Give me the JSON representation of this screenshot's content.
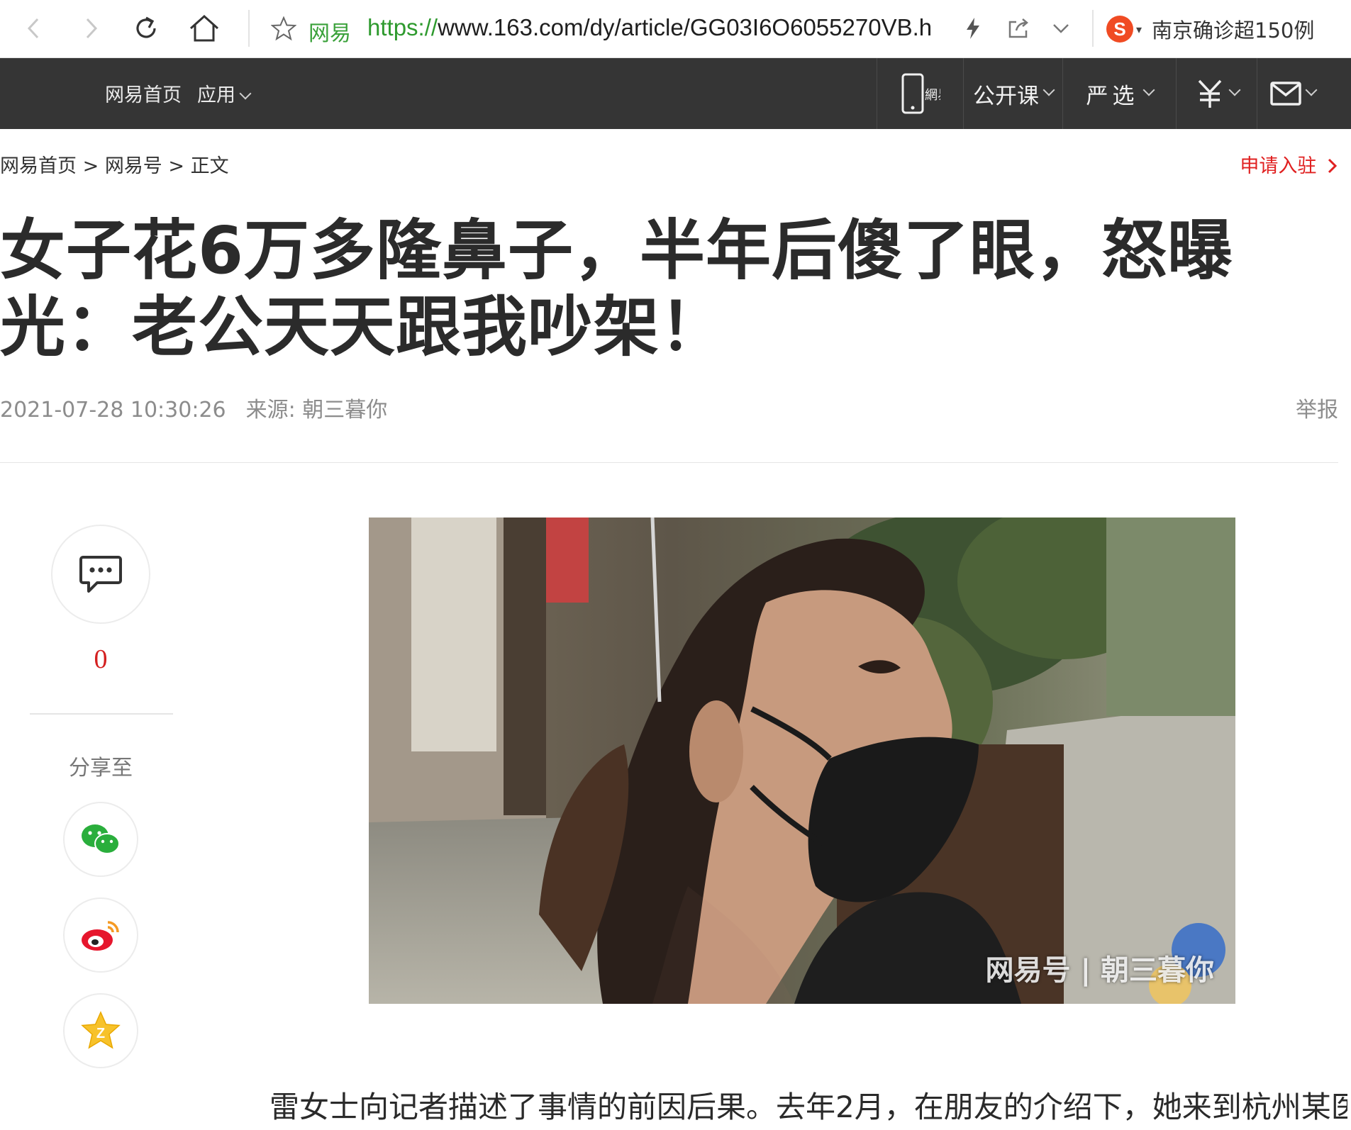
{
  "browser": {
    "site_tag": "网易",
    "url_scheme": "https://",
    "url_rest": "www.163.com/dy/article/GG03I6O6055270VB.h",
    "search_text": "南京确诊超150例",
    "search_engine_letter": "S"
  },
  "site_nav": {
    "home": "网易首页",
    "apps": "应用",
    "app_icon_text": "網易",
    "open_course": "公开课",
    "yanxuan": "严选"
  },
  "breadcrumb": {
    "home": "网易首页",
    "sep1": ">",
    "channel": "网易号",
    "sep2": ">",
    "current": "正文"
  },
  "join_link": "申请入驻",
  "article": {
    "title": "女子花6万多隆鼻子，半年后傻了眼，怒曝光：老公天天跟我吵架！",
    "timestamp": "2021-07-28 10:30:26",
    "source": "来源: 朝三暮你",
    "report": "举报",
    "image_watermark": "网易号 | 朝三暮你",
    "first_paragraph": "雷女士向记者描述了事情的前因后果。去年2月，在朋友的介绍下，她来到杭州某医"
  },
  "rail": {
    "comment_count": "0",
    "share_label": "分享至"
  },
  "colors": {
    "nav_bg": "#353535",
    "accent_red": "#e02020",
    "url_green": "#2e9a2e"
  }
}
